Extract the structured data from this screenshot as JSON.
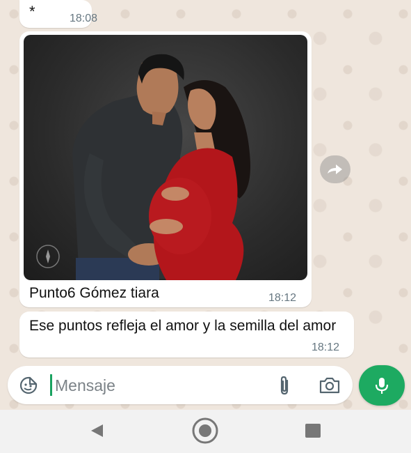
{
  "messages": [
    {
      "text": "*",
      "time": "18:08"
    },
    {
      "caption": "Punto6 Gómez tiara",
      "time": "18:12",
      "image": "pregnant-couple-photo"
    },
    {
      "text": "Ese puntos refleja el amor y la semilla del amor",
      "time": "18:12"
    }
  ],
  "composer": {
    "placeholder": "Mensaje",
    "value": ""
  },
  "icons": {
    "emoji": "sticker-emoji-icon",
    "attach": "paperclip-icon",
    "camera": "camera-icon",
    "mic": "microphone-icon",
    "forward": "forward-icon",
    "nav_back": "back-triangle-icon",
    "nav_home": "home-circle-icon",
    "nav_recent": "recent-apps-icon"
  },
  "colors": {
    "accent": "#1daa61",
    "chat_background": "#efe6dd",
    "bubble": "#ffffff",
    "time_text": "#667781"
  }
}
